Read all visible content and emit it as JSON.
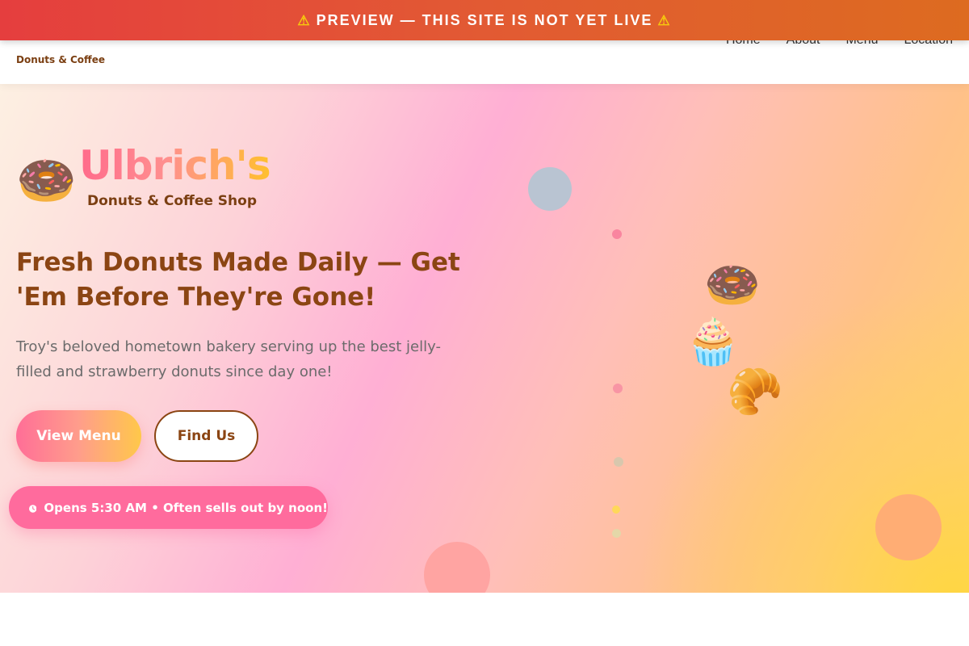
{
  "banner": {
    "icon_left": "warning-icon",
    "text": "PREVIEW — THIS SITE IS NOT YET LIVE",
    "icon_right": "warning-icon",
    "color_start": "#e53e3e",
    "color_end": "#dd6b20"
  },
  "nav": {
    "brand_subtitle": "Donuts & Coffee",
    "links": [
      "Home",
      "About",
      "Menu",
      "Location"
    ]
  },
  "hero": {
    "logo_icon": "🍩",
    "logo_name": "Ulbrich's",
    "logo_tagline": "Donuts & Coffee Shop",
    "headline": "Fresh Donuts Made Daily — Get 'Em Before They're Gone!",
    "description": "Troy's beloved hometown bakery serving up the best jelly-filled and strawberry donuts since day one!",
    "primary_button": "View Menu",
    "secondary_button": "Find Us",
    "hours_icon": "clock-icon",
    "hours_text": "Opens 5:30 AM • Often sells out by noon!",
    "floating_items": [
      "🍩",
      "🧁",
      "🥐"
    ]
  },
  "colors": {
    "brand_brown": "#8b4513",
    "accent_pink": "#ff6b9d",
    "accent_yellow": "#ffd36a"
  }
}
